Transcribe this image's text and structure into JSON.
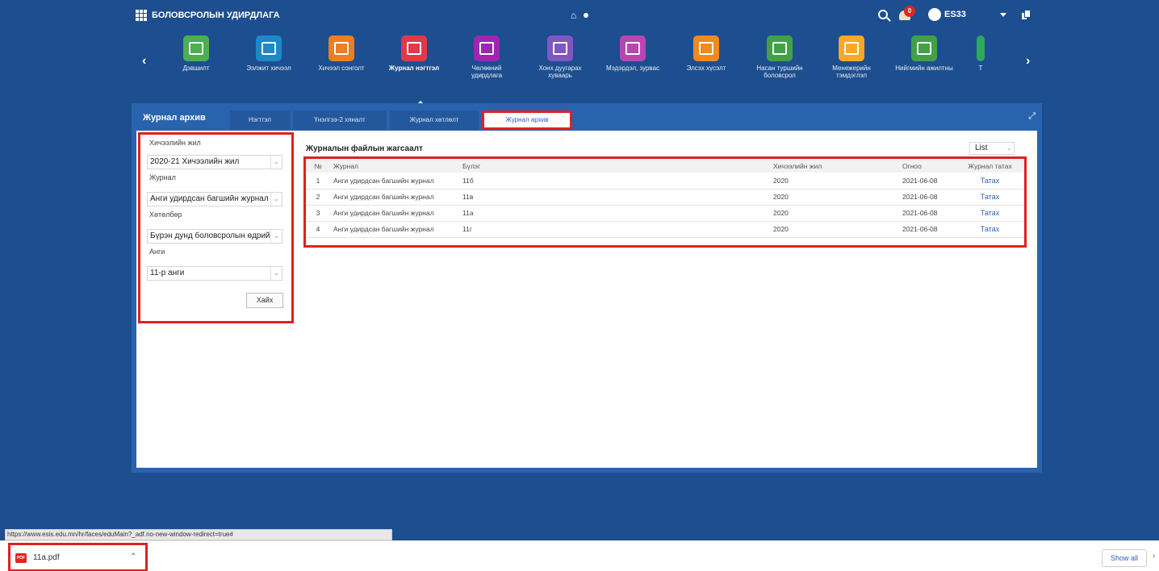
{
  "header": {
    "app_title": "БОЛОВСРОЛЫН УДИРДЛАГА",
    "user_name": "ES33",
    "notification_count": "0"
  },
  "modules": {
    "items": [
      {
        "label": "Дэвшилт",
        "color": "#4caf50",
        "icon": "certificate-icon"
      },
      {
        "label": "Ээлжит хичээл",
        "color": "#1e88c8",
        "icon": "reading-icon"
      },
      {
        "label": "Хичээл сонголт",
        "color": "#ef7d21",
        "icon": "checklist-icon"
      },
      {
        "label": "Журнал нэгтгэл",
        "color": "#e0394d",
        "icon": "journal-check-icon",
        "active": true
      },
      {
        "label": "Чөлөөний удирдлага",
        "color": "#9c27b0",
        "icon": "document-edit-icon"
      },
      {
        "label": "Хонх дуугарах хуваарь",
        "color": "#7e57c2",
        "icon": "schedule-icon"
      },
      {
        "label": "Мэдэрдэл, зурвас",
        "color": "#b547b0",
        "icon": "mail-icon"
      },
      {
        "label": "Элсэх хүсэлт",
        "color": "#ef8a1e",
        "icon": "group-add-icon"
      },
      {
        "label": "Насан туршийн боловсрол",
        "color": "#43a047",
        "icon": "hand-plant-icon"
      },
      {
        "label": "Менежерийн тэмдэглэл",
        "color": "#f9a825",
        "icon": "notebook-icon"
      },
      {
        "label": "Нийгмийн ажилтны",
        "color": "#43a047",
        "icon": "social-worker-icon"
      },
      {
        "label": "Т",
        "color": "#2eaa5c",
        "icon": "more-icon"
      }
    ]
  },
  "panel": {
    "title": "Журнал архив",
    "tabs": [
      "Нэгтгэл",
      "Үнэлгээ-2 хяналт",
      "Журнал хөтлөлт",
      "Журнал архив"
    ],
    "active_tab": 3
  },
  "filters": {
    "school_year_label": "Хичээлийн жил",
    "school_year_value": "2020-21 Хичээлийн жил",
    "journal_label": "Журнал",
    "journal_value": "Анги удирдсан багшийн журнал",
    "program_label": "Хөтөлбөр",
    "program_value": "Бүрэн дунд боловсролын өдрийн",
    "class_label": "Анги",
    "class_value": "11-р анги",
    "search_button": "Хайх"
  },
  "results": {
    "title": "Журналын файлын жагсаалт",
    "view_select": "List",
    "columns": [
      "№",
      "Журнал",
      "Бүлэг",
      "Хичээлийн жил",
      "Огноо",
      "Журнал татах"
    ],
    "rows": [
      {
        "num": "1",
        "journal": "Анги удирдсан багшийн журнал",
        "group": "11б",
        "year": "2020",
        "date": "2021-06-08",
        "action": "Татах"
      },
      {
        "num": "2",
        "journal": "Анги удирдсан багшийн журнал",
        "group": "11в",
        "year": "2020",
        "date": "2021-06-08",
        "action": "Татах"
      },
      {
        "num": "3",
        "journal": "Анги удирдсан багшийн журнал",
        "group": "11а",
        "year": "2020",
        "date": "2021-06-08",
        "action": "Татах"
      },
      {
        "num": "4",
        "journal": "Анги удирдсан багшийн журнал",
        "group": "11г",
        "year": "2020",
        "date": "2021-06-08",
        "action": "Татах"
      }
    ]
  },
  "status_url": "https://www.esis.edu.mn/hr/faces/eduMain?_adf.no-new-window-redirect=true#",
  "download": {
    "file_name": "11a.pdf",
    "file_type": "PDF",
    "show_all": "Show all"
  }
}
